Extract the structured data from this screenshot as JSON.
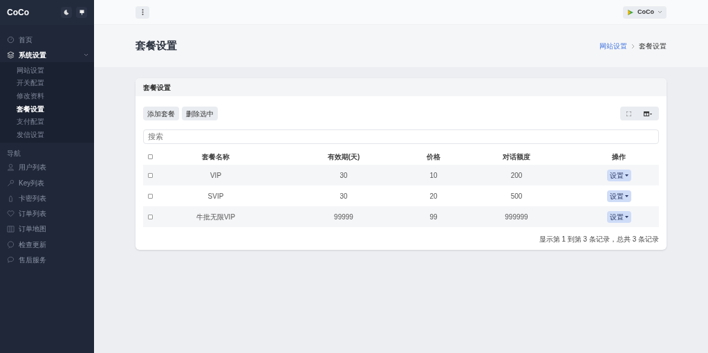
{
  "sidebar": {
    "brand": "CoCo",
    "menu": [
      {
        "label": "首页",
        "selected": false
      },
      {
        "label": "系统设置",
        "expanded": true,
        "selected": true,
        "children": [
          {
            "label": "网站设置",
            "selected": false
          },
          {
            "label": "开关配置",
            "selected": false
          },
          {
            "label": "修改资料",
            "selected": false
          },
          {
            "label": "套餐设置",
            "selected": true
          },
          {
            "label": "支付配置",
            "selected": false
          },
          {
            "label": "发信设置",
            "selected": false
          }
        ]
      }
    ],
    "section": "导航",
    "nav": [
      {
        "label": "用户列表"
      },
      {
        "label": "Key列表"
      },
      {
        "label": "卡密列表"
      },
      {
        "label": "订单列表"
      },
      {
        "label": "订单地图"
      },
      {
        "label": "检查更新"
      },
      {
        "label": "售后服务"
      }
    ]
  },
  "topbar": {
    "user": "CoCo"
  },
  "page": {
    "title": "套餐设置",
    "breadcrumb": [
      {
        "label": "网站设置",
        "selected": false
      },
      {
        "label": "套餐设置",
        "selected": true
      }
    ]
  },
  "card": {
    "title": "套餐设置",
    "buttons": [
      "添加套餐",
      "删除选中"
    ],
    "search": {
      "placeholder": "搜索"
    },
    "table": {
      "select_all_checked": false,
      "columns": [
        "套餐名称",
        "有效期(天)",
        "价格",
        "对话额度",
        "操作"
      ],
      "rows": [
        {
          "checked": false,
          "cells": [
            "VIP",
            "30",
            "10",
            "200"
          ],
          "action": "设置"
        },
        {
          "checked": false,
          "cells": [
            "SVIP",
            "30",
            "20",
            "500"
          ],
          "action": "设置"
        },
        {
          "checked": false,
          "cells": [
            "牛批无限VIP",
            "99999",
            "99",
            "999999"
          ],
          "action": "设置"
        }
      ]
    },
    "footer": "显示第 1 到第 3 条记录，总共 3 条记录"
  }
}
